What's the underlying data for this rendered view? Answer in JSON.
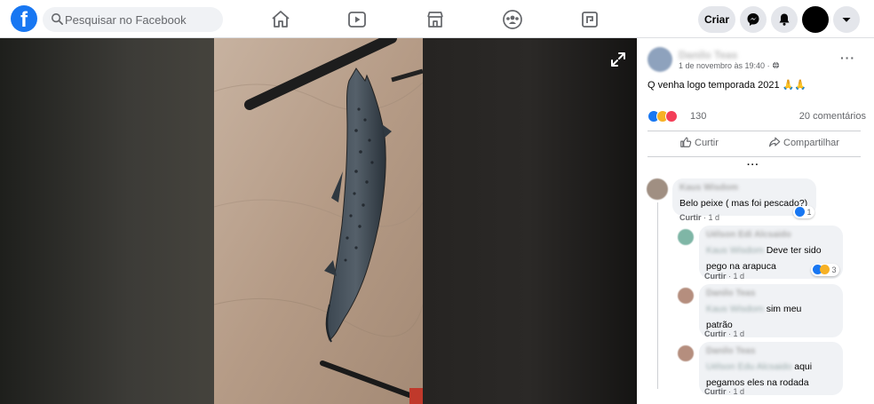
{
  "topbar": {
    "search_placeholder": "Pesquisar no Facebook",
    "create_label": "Criar",
    "nav_icons": [
      "home-icon",
      "video-icon",
      "marketplace-icon",
      "groups-icon",
      "gaming-icon"
    ]
  },
  "post": {
    "author": "Danilo Teas",
    "time": "1 de novembro às 19:40 · ",
    "text": "Q venha logo temporada 2021 🙏🙏",
    "reaction_count": "130",
    "comment_count": "20 comentários",
    "like_label": "Curtir",
    "share_label": "Compartilhar",
    "more_dots": "···"
  },
  "comments": [
    {
      "name": "Kaus Wisdom",
      "text": "Belo peixe ( mas foi pescado?)",
      "action": "Curtir",
      "time": " · 1 d",
      "reactions": "1"
    },
    {
      "name": "Uélson Edi Alcsaido",
      "mention": "Kaus Wisdom",
      "text_line1": " Deve ter sido",
      "text_line2": "pego na arapuca",
      "action": "Curtir",
      "time": " · 1 d",
      "reactions": "3"
    },
    {
      "name": "Danilo Teas",
      "mention": "Kaus Wisdom",
      "text_line1": " sim meu",
      "text_line2": "patrão",
      "action": "Curtir",
      "time": " · 1 d"
    },
    {
      "name": "Danilo Teas",
      "mention": "Uélson Edu Alcsaido",
      "text_line1": " aqui",
      "text_line2": "pegamos eles na rodada",
      "action": "Curtir",
      "time": " · 1 d"
    }
  ],
  "colors": {
    "brand": "#1877f2",
    "like": "#1877f2",
    "love": "#f33e58",
    "haha": "#f7b125"
  }
}
